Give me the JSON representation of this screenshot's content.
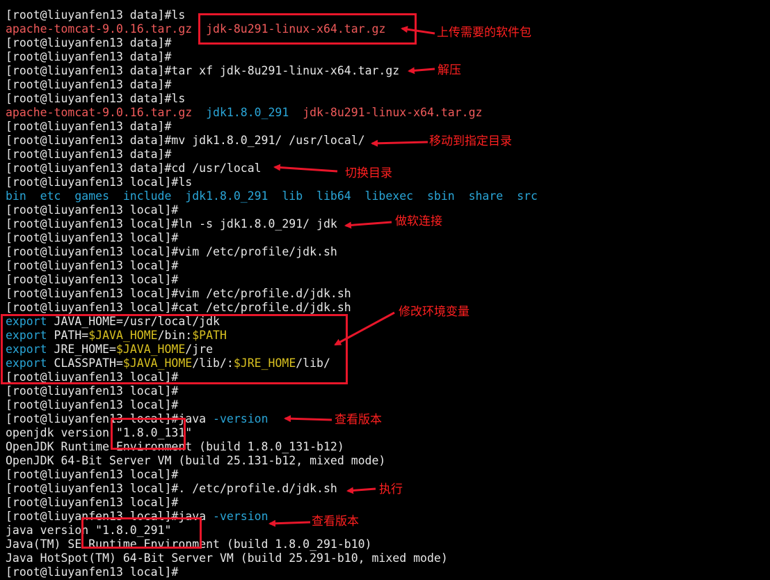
{
  "terminal": {
    "lines": [
      {
        "segs": [
          {
            "t": "[root@liuyanfen13 data]#",
            "c": "p"
          },
          {
            "t": "ls",
            "c": "p"
          }
        ]
      },
      {
        "segs": [
          {
            "t": "apache-tomcat-9.0.16.tar.gz",
            "c": "red"
          },
          {
            "t": "  ",
            "c": "p"
          },
          {
            "t": "jdk-8u291-linux-x64.tar.gz",
            "c": "red"
          }
        ]
      },
      {
        "segs": [
          {
            "t": "[root@liuyanfen13 data]#",
            "c": "p"
          }
        ]
      },
      {
        "segs": [
          {
            "t": "[root@liuyanfen13 data]#",
            "c": "p"
          }
        ]
      },
      {
        "segs": [
          {
            "t": "[root@liuyanfen13 data]#",
            "c": "p"
          },
          {
            "t": "tar xf jdk-8u291-linux-x64.tar.gz",
            "c": "p"
          }
        ]
      },
      {
        "segs": [
          {
            "t": "[root@liuyanfen13 data]#",
            "c": "p"
          }
        ]
      },
      {
        "segs": [
          {
            "t": "[root@liuyanfen13 data]#",
            "c": "p"
          },
          {
            "t": "ls",
            "c": "p"
          }
        ]
      },
      {
        "segs": [
          {
            "t": "apache-tomcat-9.0.16.tar.gz",
            "c": "red"
          },
          {
            "t": "  ",
            "c": "p"
          },
          {
            "t": "jdk1.8.0_291",
            "c": "blue"
          },
          {
            "t": "  ",
            "c": "p"
          },
          {
            "t": "jdk-8u291-linux-x64.tar.gz",
            "c": "red"
          }
        ]
      },
      {
        "segs": [
          {
            "t": "[root@liuyanfen13 data]#",
            "c": "p"
          }
        ]
      },
      {
        "segs": [
          {
            "t": "[root@liuyanfen13 data]#",
            "c": "p"
          },
          {
            "t": "mv jdk1.8.0_291/ /usr/local/",
            "c": "p"
          }
        ]
      },
      {
        "segs": [
          {
            "t": "[root@liuyanfen13 data]#",
            "c": "p"
          }
        ]
      },
      {
        "segs": [
          {
            "t": "[root@liuyanfen13 data]#",
            "c": "p"
          },
          {
            "t": "cd /usr/local",
            "c": "p"
          }
        ]
      },
      {
        "segs": [
          {
            "t": "[root@liuyanfen13 local]#",
            "c": "p"
          },
          {
            "t": "ls",
            "c": "p"
          }
        ]
      },
      {
        "segs": [
          {
            "t": "bin  etc  games  include  jdk1.8.0_291  lib  lib64  libexec  sbin  share  src",
            "c": "blue"
          }
        ]
      },
      {
        "segs": [
          {
            "t": "[root@liuyanfen13 local]#",
            "c": "p"
          }
        ]
      },
      {
        "segs": [
          {
            "t": "[root@liuyanfen13 local]#",
            "c": "p"
          },
          {
            "t": "ln -s jdk1.8.0_291/ jdk",
            "c": "p"
          }
        ]
      },
      {
        "segs": [
          {
            "t": "[root@liuyanfen13 local]#",
            "c": "p"
          }
        ]
      },
      {
        "segs": [
          {
            "t": "[root@liuyanfen13 local]#",
            "c": "p"
          },
          {
            "t": "vim /etc/profile/jdk.sh",
            "c": "p"
          }
        ]
      },
      {
        "segs": [
          {
            "t": "[root@liuyanfen13 local]#",
            "c": "p"
          }
        ]
      },
      {
        "segs": [
          {
            "t": "[root@liuyanfen13 local]#",
            "c": "p"
          }
        ]
      },
      {
        "segs": [
          {
            "t": "[root@liuyanfen13 local]#",
            "c": "p"
          },
          {
            "t": "vim /etc/profile.d/jdk.sh",
            "c": "p"
          }
        ]
      },
      {
        "segs": [
          {
            "t": "[root@liuyanfen13 local]#",
            "c": "p"
          },
          {
            "t": "cat /etc/profile.d/jdk.sh",
            "c": "p"
          }
        ]
      },
      {
        "segs": [
          {
            "t": "export",
            "c": "blue"
          },
          {
            "t": " JAVA_HOME=/usr/local/jdk",
            "c": "p"
          }
        ]
      },
      {
        "segs": [
          {
            "t": "export",
            "c": "blue"
          },
          {
            "t": " PATH=",
            "c": "p"
          },
          {
            "t": "$JAVA_HOME",
            "c": "yel"
          },
          {
            "t": "/bin:",
            "c": "p"
          },
          {
            "t": "$PATH",
            "c": "yel"
          }
        ]
      },
      {
        "segs": [
          {
            "t": "export",
            "c": "blue"
          },
          {
            "t": " JRE_HOME=",
            "c": "p"
          },
          {
            "t": "$JAVA_HOME",
            "c": "yel"
          },
          {
            "t": "/jre",
            "c": "p"
          }
        ]
      },
      {
        "segs": [
          {
            "t": "export",
            "c": "blue"
          },
          {
            "t": " CLASSPATH=",
            "c": "p"
          },
          {
            "t": "$JAVA_HOME",
            "c": "yel"
          },
          {
            "t": "/lib/:",
            "c": "p"
          },
          {
            "t": "$JRE_HOME",
            "c": "yel"
          },
          {
            "t": "/lib/",
            "c": "p"
          }
        ]
      },
      {
        "segs": [
          {
            "t": "[root@liuyanfen13 local]#",
            "c": "p"
          }
        ]
      },
      {
        "segs": [
          {
            "t": "[root@liuyanfen13 local]#",
            "c": "p"
          }
        ]
      },
      {
        "segs": [
          {
            "t": "[root@liuyanfen13 local]#",
            "c": "p"
          }
        ]
      },
      {
        "segs": [
          {
            "t": "[root@liuyanfen13 local]#",
            "c": "p"
          },
          {
            "t": "java ",
            "c": "p"
          },
          {
            "t": "-version",
            "c": "blue"
          }
        ]
      },
      {
        "segs": [
          {
            "t": "openjdk version \"1.8.0_131\"",
            "c": "p"
          }
        ]
      },
      {
        "segs": [
          {
            "t": "OpenJDK Runtime Environment (build 1.8.0_131-b12)",
            "c": "p"
          }
        ]
      },
      {
        "segs": [
          {
            "t": "OpenJDK 64-Bit Server VM (build 25.131-b12, mixed mode)",
            "c": "p"
          }
        ]
      },
      {
        "segs": [
          {
            "t": "[root@liuyanfen13 local]#",
            "c": "p"
          }
        ]
      },
      {
        "segs": [
          {
            "t": "[root@liuyanfen13 local]#",
            "c": "p"
          },
          {
            "t": ". /etc/profile.d/jdk.sh",
            "c": "p"
          }
        ]
      },
      {
        "segs": [
          {
            "t": "[root@liuyanfen13 local]#",
            "c": "p"
          }
        ]
      },
      {
        "segs": [
          {
            "t": "[root@liuyanfen13 local]#",
            "c": "p"
          },
          {
            "t": "java ",
            "c": "p"
          },
          {
            "t": "-version",
            "c": "blue"
          }
        ]
      },
      {
        "segs": [
          {
            "t": "java version \"1.8.0_291\"",
            "c": "p"
          }
        ]
      },
      {
        "segs": [
          {
            "t": "Java(TM) SE Runtime Environment (build 1.8.0_291-b10)",
            "c": "p"
          }
        ]
      },
      {
        "segs": [
          {
            "t": "Java HotSpot(TM) 64-Bit Server VM (build 25.291-b10, mixed mode)",
            "c": "p"
          }
        ]
      },
      {
        "segs": [
          {
            "t": "[root@liuyanfen13 local]#",
            "c": "p"
          }
        ]
      }
    ]
  },
  "annotations": {
    "upload": "上传需要的软件包",
    "extract": "解压",
    "move": "移动到指定目录",
    "cd": "切换目录",
    "symlink": "做软连接",
    "env": "修改环境变量",
    "check1": "查看版本",
    "exec": "执行",
    "check2": "查看版本"
  },
  "colors": {
    "background": "#000000",
    "prompt": "#e8e8e8",
    "archive": "#f05a5a",
    "directory": "#2aa6d8",
    "variable": "#d8c020",
    "annotation": "#ff2020"
  }
}
